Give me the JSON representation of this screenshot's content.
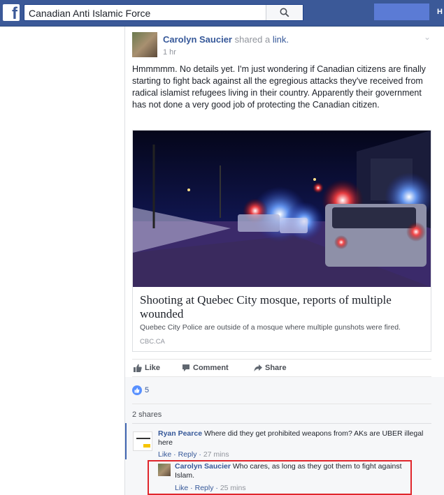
{
  "topbar": {
    "logo": "f",
    "search_value": "Canadian Anti Islamic Force",
    "edge_text": "H"
  },
  "post": {
    "author": "Carolyn Saucier",
    "action_prefix": "shared a",
    "action_link": "link.",
    "time": "1 hr",
    "text": "Hmmmmm. No details yet. I'm just wondering if Canadian citizens are finally starting to fight back against all the egregious attacks they've received from radical islamist refugees living in their country. Apparently their government has not done a very good job of protecting the Canadian citizen.",
    "link": {
      "title": "Shooting at Quebec City mosque, reports of multiple wounded",
      "description": "Quebec City Police are outside of a mosque where multiple gunshots were fired.",
      "source": "CBC.CA"
    },
    "actions": {
      "like": "Like",
      "comment": "Comment",
      "share": "Share"
    },
    "reactions_count": "5",
    "shares": "2 shares"
  },
  "comments": [
    {
      "author": "Ryan Pearce",
      "text": "Where did they get prohibited weapons from? AKs are UBER illegal here",
      "like": "Like",
      "reply": "Reply",
      "time": "27 mins"
    },
    {
      "author": "Carolyn Saucier",
      "text": "Who cares, as long as they got them to fight against Islam.",
      "like": "Like",
      "reply": "Reply",
      "time": "25 mins"
    }
  ],
  "colors": {
    "brand": "#3b5998",
    "link": "#365899",
    "highlight": "#e0262c"
  }
}
